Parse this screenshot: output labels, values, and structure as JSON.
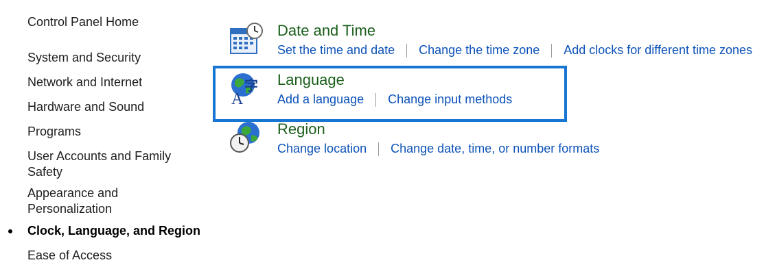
{
  "sidebar": {
    "home": "Control Panel Home",
    "items": [
      {
        "label": "System and Security"
      },
      {
        "label": "Network and Internet"
      },
      {
        "label": "Hardware and Sound"
      },
      {
        "label": "Programs"
      },
      {
        "label": "User Accounts and Family Safety"
      },
      {
        "label": "Appearance and Personalization"
      },
      {
        "label": "Clock, Language, and Region"
      },
      {
        "label": "Ease of Access"
      }
    ]
  },
  "main": {
    "categories": [
      {
        "title": "Date and Time",
        "icon": "calendar-clock-icon",
        "links": [
          "Set the time and date",
          "Change the time zone",
          "Add clocks for different time zones"
        ]
      },
      {
        "title": "Language",
        "icon": "globe-language-icon",
        "links": [
          "Add a language",
          "Change input methods"
        ]
      },
      {
        "title": "Region",
        "icon": "globe-clock-icon",
        "links": [
          "Change location",
          "Change date, time, or number formats"
        ]
      }
    ]
  },
  "colors": {
    "title_green": "#1a5e1a",
    "link_blue": "#0c52b8",
    "highlight_border": "#1776d2"
  }
}
